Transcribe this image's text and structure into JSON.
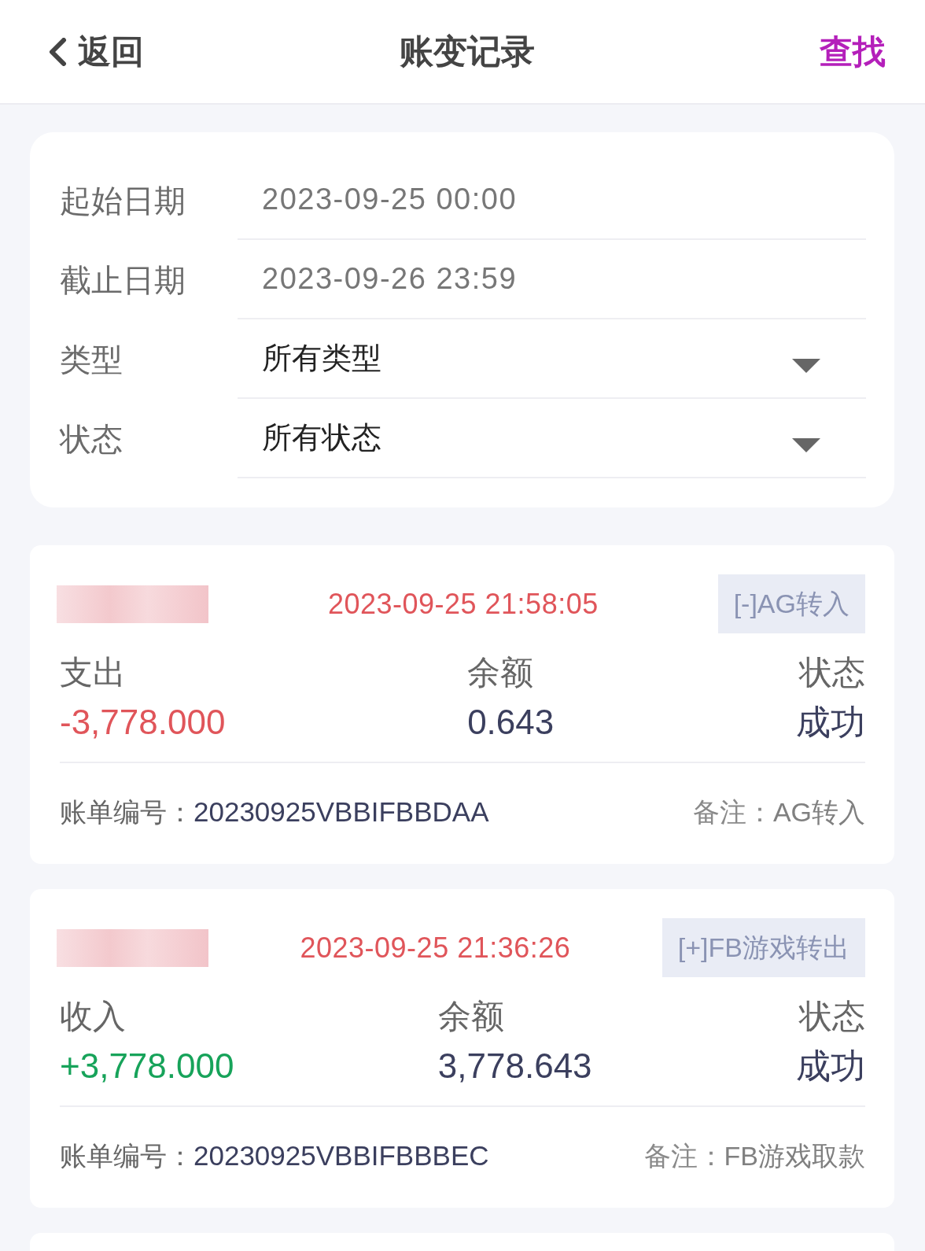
{
  "header": {
    "back_label": "返回",
    "title": "账变记录",
    "search_label": "查找"
  },
  "filters": [
    {
      "kind": "date",
      "label": "起始日期",
      "value": "2023-09-25 00:00"
    },
    {
      "kind": "date",
      "label": "截止日期",
      "value": "2023-09-26 23:59"
    },
    {
      "kind": "select",
      "label": "类型",
      "value": "所有类型"
    },
    {
      "kind": "select",
      "label": "状态",
      "value": "所有状态"
    }
  ],
  "records": [
    {
      "time": "2023-09-25 21:58:05",
      "tag": "[-]AG转入",
      "amount": {
        "label": "支出",
        "value": "-3,778.000",
        "kind": "expense"
      },
      "balance": {
        "label": "余额",
        "value": "0.643"
      },
      "status": {
        "label": "状态",
        "value": "成功"
      },
      "bill_label": "账单编号：",
      "bill_number": "20230925VBBIFBBDAA",
      "note_label": "备注：",
      "note": "AG转入"
    },
    {
      "time": "2023-09-25 21:36:26",
      "tag": "[+]FB游戏转出",
      "amount": {
        "label": "收入",
        "value": "+3,778.000",
        "kind": "income"
      },
      "balance": {
        "label": "余额",
        "value": "3,778.643"
      },
      "status": {
        "label": "状态",
        "value": "成功"
      },
      "bill_label": "账单编号：",
      "bill_number": "20230925VBBIFBBBEC",
      "note_label": "备注：",
      "note": "FB游戏取款"
    }
  ]
}
